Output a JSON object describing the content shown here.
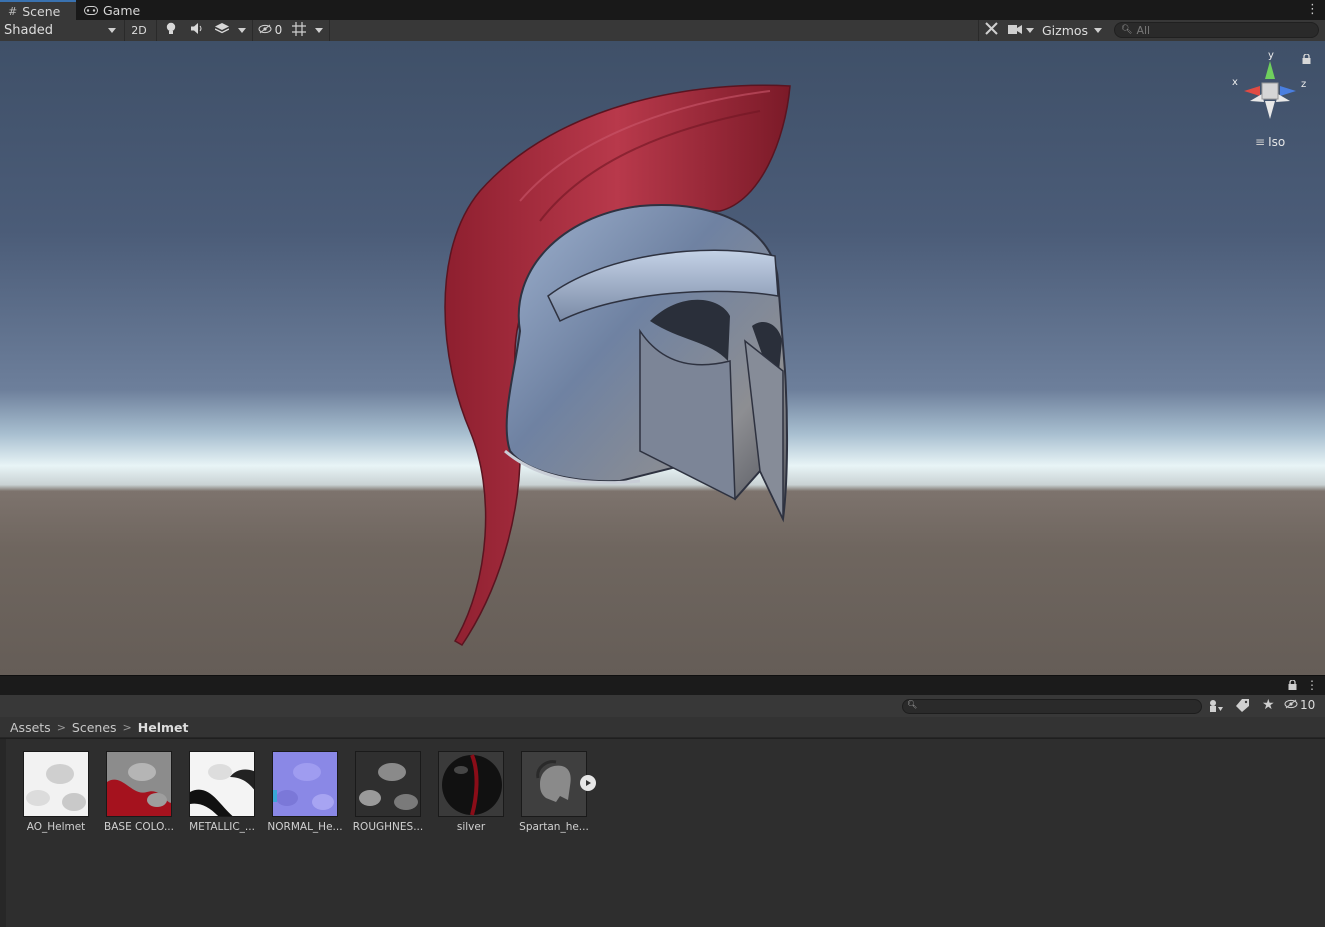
{
  "tabs": [
    {
      "label": "Scene",
      "icon": "grid-icon",
      "active": true
    },
    {
      "label": "Game",
      "icon": "gamepad-icon",
      "active": false
    }
  ],
  "toolbar": {
    "shading_mode": "Shaded",
    "mode_2d": "2D",
    "hidden_count": "0",
    "gizmos_label": "Gizmos",
    "search_placeholder": "All"
  },
  "viewport": {
    "projection": "Iso",
    "axis_labels": {
      "x": "x",
      "y": "y",
      "z": "z"
    }
  },
  "project": {
    "hidden_count": "10",
    "breadcrumb": [
      "Assets",
      "Scenes",
      "Helmet"
    ],
    "assets": [
      {
        "label": "AO_Helmet",
        "kind": "texture-ao"
      },
      {
        "label": "BASE COLO...",
        "kind": "texture-basecolor"
      },
      {
        "label": "METALLIC_...",
        "kind": "texture-metallic"
      },
      {
        "label": "NORMAL_He...",
        "kind": "texture-normal"
      },
      {
        "label": "ROUGHNES...",
        "kind": "texture-roughness"
      },
      {
        "label": "silver",
        "kind": "material"
      },
      {
        "label": "Spartan_he...",
        "kind": "model"
      }
    ]
  },
  "colors": {
    "accent": "#3a72b0",
    "plume": "#a3283a",
    "sky_top": "#3f5068",
    "ground": "#6f665f"
  }
}
